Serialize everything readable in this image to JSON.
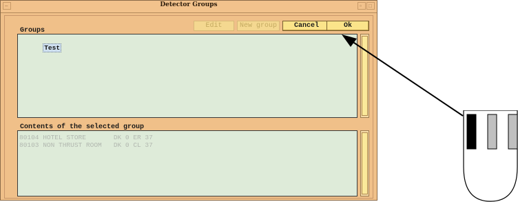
{
  "window": {
    "title": "Detector Groups"
  },
  "toolbar": {
    "edit_label": "Edit",
    "new_group_label": "New group",
    "cancel_label": "Cancel",
    "ok_label": "Ok"
  },
  "groups": {
    "label": "Groups",
    "items": [
      "Test"
    ],
    "selected": "Test"
  },
  "contents": {
    "label": "Contents of the selected group",
    "items": [
      "80104 HOTEL STORE       DK 0 ER 37",
      "80103 NON THRUST ROOM   DK 0 CL 37"
    ]
  },
  "colors": {
    "window_bg": "#f0c089",
    "list_bg": "#deebd9",
    "button_bg": "#fbe48a",
    "arrow": "#000000"
  },
  "icons": {
    "arrow": "annotation-arrow",
    "device": "hand-device-icon"
  }
}
